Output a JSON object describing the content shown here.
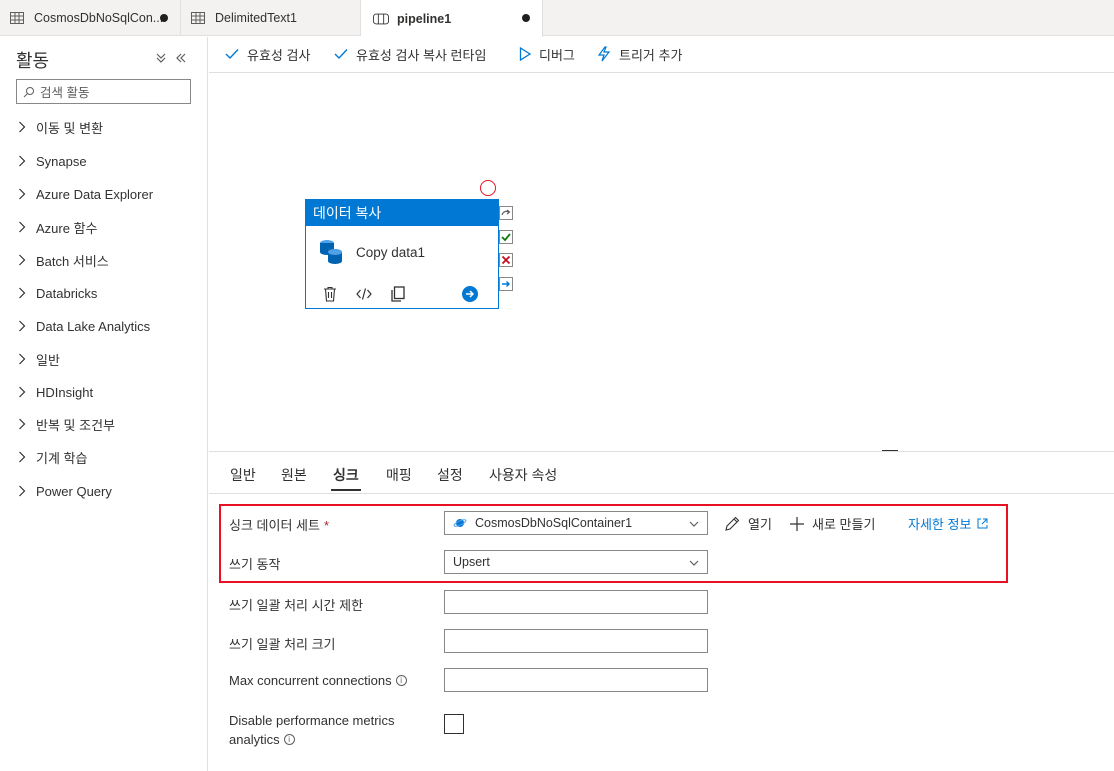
{
  "tabs": [
    {
      "label": "CosmosDbNoSqlCon...",
      "icon": "table-icon",
      "unsaved": true
    },
    {
      "label": "DelimitedText1",
      "icon": "table-icon",
      "unsaved": false
    },
    {
      "label": "pipeline1",
      "icon": "pipeline-icon",
      "unsaved": true
    }
  ],
  "sidebar": {
    "title": "활동",
    "search_placeholder": "검색 활동",
    "items": [
      {
        "label": "이동 및 변환"
      },
      {
        "label": "Synapse"
      },
      {
        "label": "Azure Data Explorer"
      },
      {
        "label": "Azure 함수"
      },
      {
        "label": "Batch 서비스"
      },
      {
        "label": "Databricks"
      },
      {
        "label": "Data Lake Analytics"
      },
      {
        "label": "일반"
      },
      {
        "label": "HDInsight"
      },
      {
        "label": "반복 및 조건부"
      },
      {
        "label": "기계 학습"
      },
      {
        "label": "Power Query"
      }
    ]
  },
  "toolbar": {
    "validate": "유효성 검사",
    "validate_copy_runtime": "유효성 검사 복사 런타임",
    "debug": "디버그",
    "add_trigger": "트리거 추가"
  },
  "activity": {
    "type_label": "데이터 복사",
    "name": "Copy data1"
  },
  "panel": {
    "tabs": [
      "일반",
      "원본",
      "싱크",
      "매핑",
      "설정",
      "사용자 속성"
    ],
    "active_tab": "싱크",
    "sink_dataset_label": "싱크 데이터 세트",
    "required_mark": "*",
    "sink_dataset_value": "CosmosDbNoSqlContainer1",
    "open_label": "열기",
    "new_label": "새로 만들기",
    "learn_more": "자세한 정보",
    "write_behavior_label": "쓰기 동작",
    "write_behavior_value": "Upsert",
    "batch_timeout_label": "쓰기 일괄 처리 시간 제한",
    "batch_timeout_value": "",
    "batch_size_label": "쓰기 일괄 처리 크기",
    "batch_size_value": "",
    "max_conn_label": "Max concurrent connections",
    "max_conn_value": "",
    "disable_metrics_label_1": "Disable performance metrics",
    "disable_metrics_label_2": "analytics",
    "disable_metrics_checked": false
  },
  "colors": {
    "accent": "#0078d4",
    "highlight_border": "#e81123",
    "success": "#107c10",
    "error": "#c50f1f"
  }
}
